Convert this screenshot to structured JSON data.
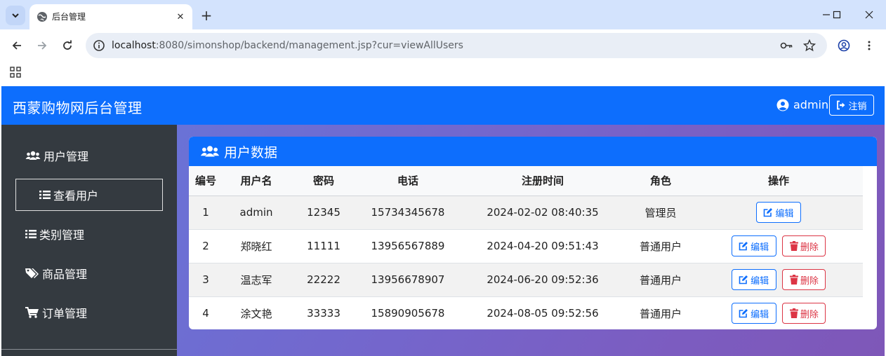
{
  "browser": {
    "tab_title": "后台管理",
    "url_host": "localhost",
    "url_path": ":8080/simonshop/backend/management.jsp?cur=viewAllUsers"
  },
  "app": {
    "brand": "西蒙购物网后台管理",
    "username": "admin",
    "logout_label": "注销",
    "accent_color": "#0d6efd",
    "danger_color": "#dc3545",
    "sidebar_color": "#343a40"
  },
  "sidebar": {
    "items": [
      {
        "label": "用户管理",
        "icon": "users-icon"
      },
      {
        "label": "查看用户",
        "icon": "list-icon"
      },
      {
        "label": "类别管理",
        "icon": "list-icon"
      },
      {
        "label": "商品管理",
        "icon": "tags-icon"
      },
      {
        "label": "订单管理",
        "icon": "cart-icon"
      }
    ]
  },
  "card": {
    "title": "用户数据",
    "columns": [
      "编号",
      "用户名",
      "密码",
      "电话",
      "注册时间",
      "角色",
      "操作"
    ],
    "rows": [
      {
        "id": "1",
        "username": "admin",
        "password": "12345",
        "phone": "15734345678",
        "registered": "2024-02-02 08:40:35",
        "role": "管理员"
      },
      {
        "id": "2",
        "username": "郑晓红",
        "password": "11111",
        "phone": "13956567889",
        "registered": "2024-04-20 09:51:43",
        "role": "普通用户"
      },
      {
        "id": "3",
        "username": "温志军",
        "password": "22222",
        "phone": "13956678907",
        "registered": "2024-06-20 09:52:36",
        "role": "普通用户"
      },
      {
        "id": "4",
        "username": "涂文艳",
        "password": "33333",
        "phone": "15890905678",
        "registered": "2024-08-05 09:52:56",
        "role": "普通用户"
      }
    ],
    "edit_label": "编辑",
    "delete_label": "删除"
  }
}
